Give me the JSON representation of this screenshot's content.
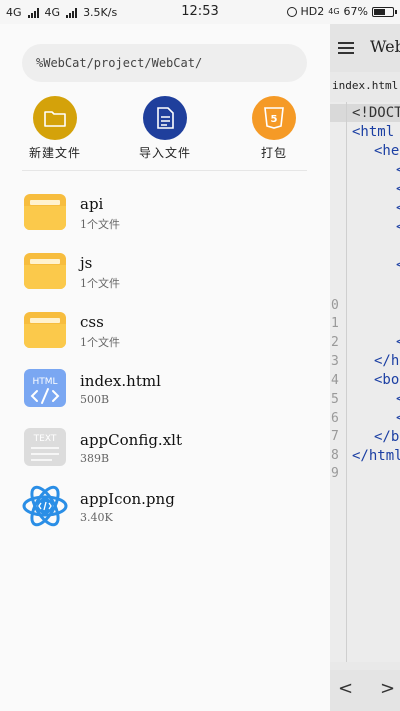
{
  "status": {
    "left1": "4G",
    "left2": "4G",
    "speed": "3.5K/s",
    "time": "12:53",
    "hd": "HD2",
    "net": "4G",
    "battery_pct": "67%",
    "battery_level": 0.67
  },
  "drawer": {
    "path": "%WebCat/project/WebCat/",
    "actions": [
      {
        "label": "新建文件",
        "color": "#d4a20a",
        "icon": "folder-icon"
      },
      {
        "label": "导入文件",
        "color": "#1f3f9c",
        "icon": "document-icon"
      },
      {
        "label": "打包",
        "color": "#f59a26",
        "icon": "html5-icon"
      }
    ],
    "files": [
      {
        "name": "api",
        "meta": "1个文件",
        "type": "folder"
      },
      {
        "name": "js",
        "meta": "1个文件",
        "type": "folder"
      },
      {
        "name": "css",
        "meta": "1个文件",
        "type": "folder"
      },
      {
        "name": "index.html",
        "meta": "500B",
        "type": "html"
      },
      {
        "name": "appConfig.xlt",
        "meta": "389B",
        "type": "text"
      },
      {
        "name": "appIcon.png",
        "meta": "3.40K",
        "type": "image"
      }
    ]
  },
  "editor": {
    "title": "WebCat",
    "filename": "index.html",
    "line_numbers": [
      "0",
      "1",
      "2",
      "3",
      "4",
      "5",
      "6",
      "7",
      "8",
      "9"
    ],
    "code": [
      "<!DOCTYPE",
      "<html",
      "<head",
      "</head",
      "<body",
      "</body",
      "</html"
    ],
    "prev": "<",
    "next": ">"
  }
}
